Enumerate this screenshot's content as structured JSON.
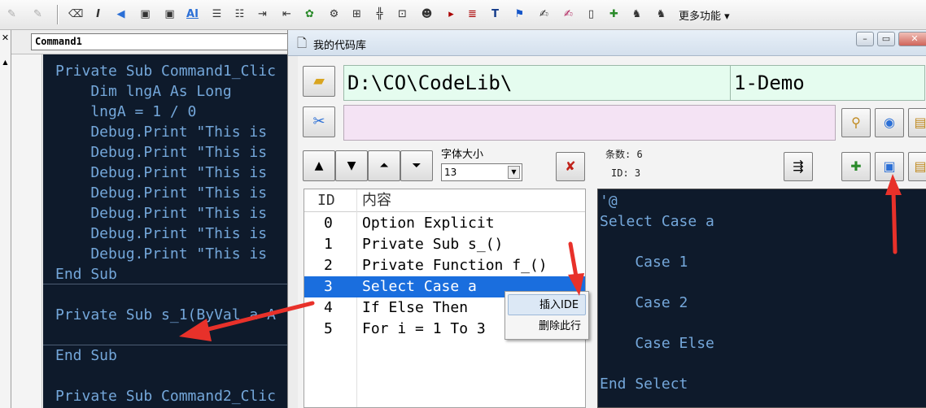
{
  "toolbar": {
    "more_label": "更多功能"
  },
  "code_window": {
    "object_combo": "Command1",
    "lines": [
      "Private Sub Command1_Clic",
      "    Dim lngA As Long",
      "    lngA = 1 / 0",
      "    Debug.Print \"This is",
      "    Debug.Print \"This is",
      "    Debug.Print \"This is",
      "    Debug.Print \"This is",
      "    Debug.Print \"This is",
      "    Debug.Print \"This is",
      "    Debug.Print \"This is",
      "End Sub",
      "",
      "Private Sub s_1(ByVal a A",
      "",
      "End Sub",
      "",
      "Private Sub Command2_Clic"
    ]
  },
  "lib": {
    "title": "我的代码库",
    "path": "D:\\CO\\CodeLib\\",
    "lib_name": "1-Demo",
    "search_text": "",
    "font_size_label": "字体大小",
    "font_size_value": "13",
    "count_label": "条数: 6",
    "id_label": "ID: 3",
    "list": {
      "col_id": "ID",
      "col_content": "内容",
      "rows": [
        {
          "id": "0",
          "content": "Option Explicit"
        },
        {
          "id": "1",
          "content": "Private Sub s_()"
        },
        {
          "id": "2",
          "content": "Private Function f_()"
        },
        {
          "id": "3",
          "content": "Select Case a"
        },
        {
          "id": "4",
          "content": "If Else Then"
        },
        {
          "id": "5",
          "content": "For i = 1 To 3"
        }
      ],
      "selected_index": 3
    },
    "preview_lines": [
      "'@",
      "Select Case a",
      "",
      "    Case 1",
      "",
      "    Case 2",
      "",
      "    Case Else",
      "",
      "End Select"
    ],
    "context_menu": {
      "insert_ide": "插入IDE",
      "delete_row": "删除此行"
    }
  },
  "colors": {
    "code_bg": "#0e1a2b",
    "code_text": "#74a7da",
    "selection": "#1a6ede",
    "path_bg": "#e5fcef",
    "search_bg": "#f4e3f4",
    "arrow": "#e8312a"
  }
}
